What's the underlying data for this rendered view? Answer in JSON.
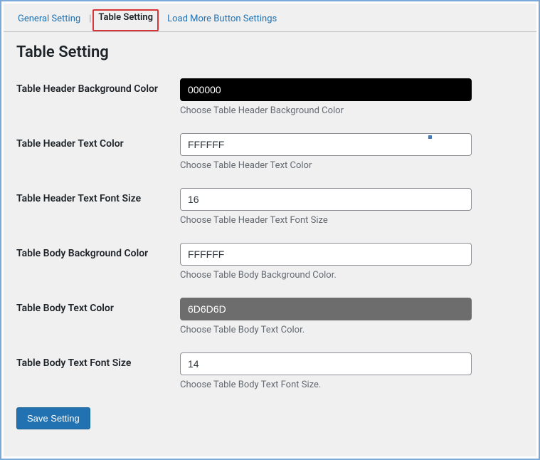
{
  "tabs": {
    "general": "General Setting",
    "table": "Table Setting",
    "loadmore": "Load More Button Settings"
  },
  "page_title": "Table Setting",
  "fields": {
    "header_bg": {
      "label": "Table Header Background Color",
      "value": "000000",
      "help": "Choose Table Header Background Color"
    },
    "header_text": {
      "label": "Table Header Text Color",
      "value": "FFFFFF",
      "help": "Choose Table Header Text Color"
    },
    "header_font": {
      "label": "Table Header Text Font Size",
      "value": "16",
      "help": "Choose Table Header Text Font Size"
    },
    "body_bg": {
      "label": "Table Body Background Color",
      "value": "FFFFFF",
      "help": "Choose Table Body Background Color."
    },
    "body_text": {
      "label": "Table Body Text Color",
      "value": "6D6D6D",
      "help": "Choose Table Body Text Color."
    },
    "body_font": {
      "label": "Table Body Text Font Size",
      "value": "14",
      "help": "Choose Table Body Text Font Size."
    }
  },
  "save_label": "Save Setting"
}
